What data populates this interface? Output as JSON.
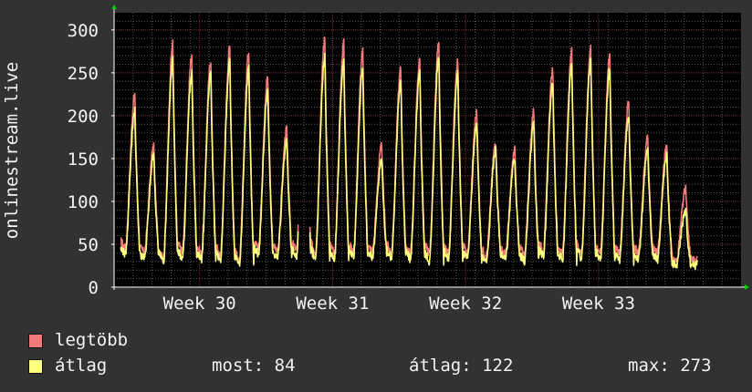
{
  "graph": {
    "vertical_label": "onlinestream.live",
    "colors": {
      "canvas": "#000000",
      "background": "#323232",
      "grid_minor": "#5a5a5a",
      "grid_major": "#7a3030",
      "max_line": "#f27a7a",
      "avg_line": "#ffff80",
      "axis": "#ffffff",
      "arrow": "#00cc00"
    }
  },
  "legend": {
    "max_label": "legtöbb",
    "avg_label": "átlag",
    "now_text": "most: 84",
    "avg_text": "átlag: 122",
    "max_text": "max: 273"
  },
  "chart_data": {
    "type": "line",
    "ylim": [
      0,
      320
    ],
    "y_ticks": [
      "0",
      "50",
      "100",
      "150",
      "200",
      "250",
      "300"
    ],
    "x_ticks": [
      "Week 30",
      "Week 31",
      "Week 32",
      "Week 33"
    ],
    "x_unit": "days",
    "xlim": [
      0,
      33
    ],
    "x_tick_positions": [
      4.5,
      11.5,
      18.5,
      25.5
    ],
    "gaps": [
      [
        9.7,
        10.3
      ]
    ],
    "grid": true,
    "series": [
      {
        "name": "legtöbb",
        "color": "#f27a7a",
        "daily_peaks": [
          225,
          165,
          285,
          270,
          265,
          280,
          275,
          245,
          185,
          265,
          290,
          285,
          275,
          165,
          255,
          265,
          285,
          265,
          205,
          170,
          160,
          205,
          255,
          275,
          280,
          270,
          215,
          175,
          165,
          115
        ],
        "daily_troughs": [
          45,
          40,
          32,
          40,
          38,
          37,
          30,
          45,
          42,
          42,
          40,
          38,
          40,
          42,
          40,
          38,
          38,
          38,
          40,
          38,
          38,
          38,
          42,
          38,
          40,
          40,
          38,
          40,
          40,
          30
        ]
      },
      {
        "name": "átlag",
        "color": "#ffff80",
        "daily_peaks": [
          205,
          155,
          265,
          250,
          250,
          265,
          255,
          230,
          170,
          250,
          270,
          265,
          255,
          150,
          240,
          250,
          270,
          250,
          190,
          160,
          150,
          190,
          240,
          260,
          265,
          255,
          200,
          160,
          155,
          90
        ],
        "daily_troughs": [
          38,
          33,
          28,
          32,
          30,
          30,
          25,
          38,
          35,
          35,
          33,
          32,
          33,
          35,
          33,
          32,
          30,
          32,
          33,
          30,
          32,
          30,
          35,
          30,
          33,
          32,
          30,
          33,
          32,
          25
        ]
      }
    ]
  }
}
